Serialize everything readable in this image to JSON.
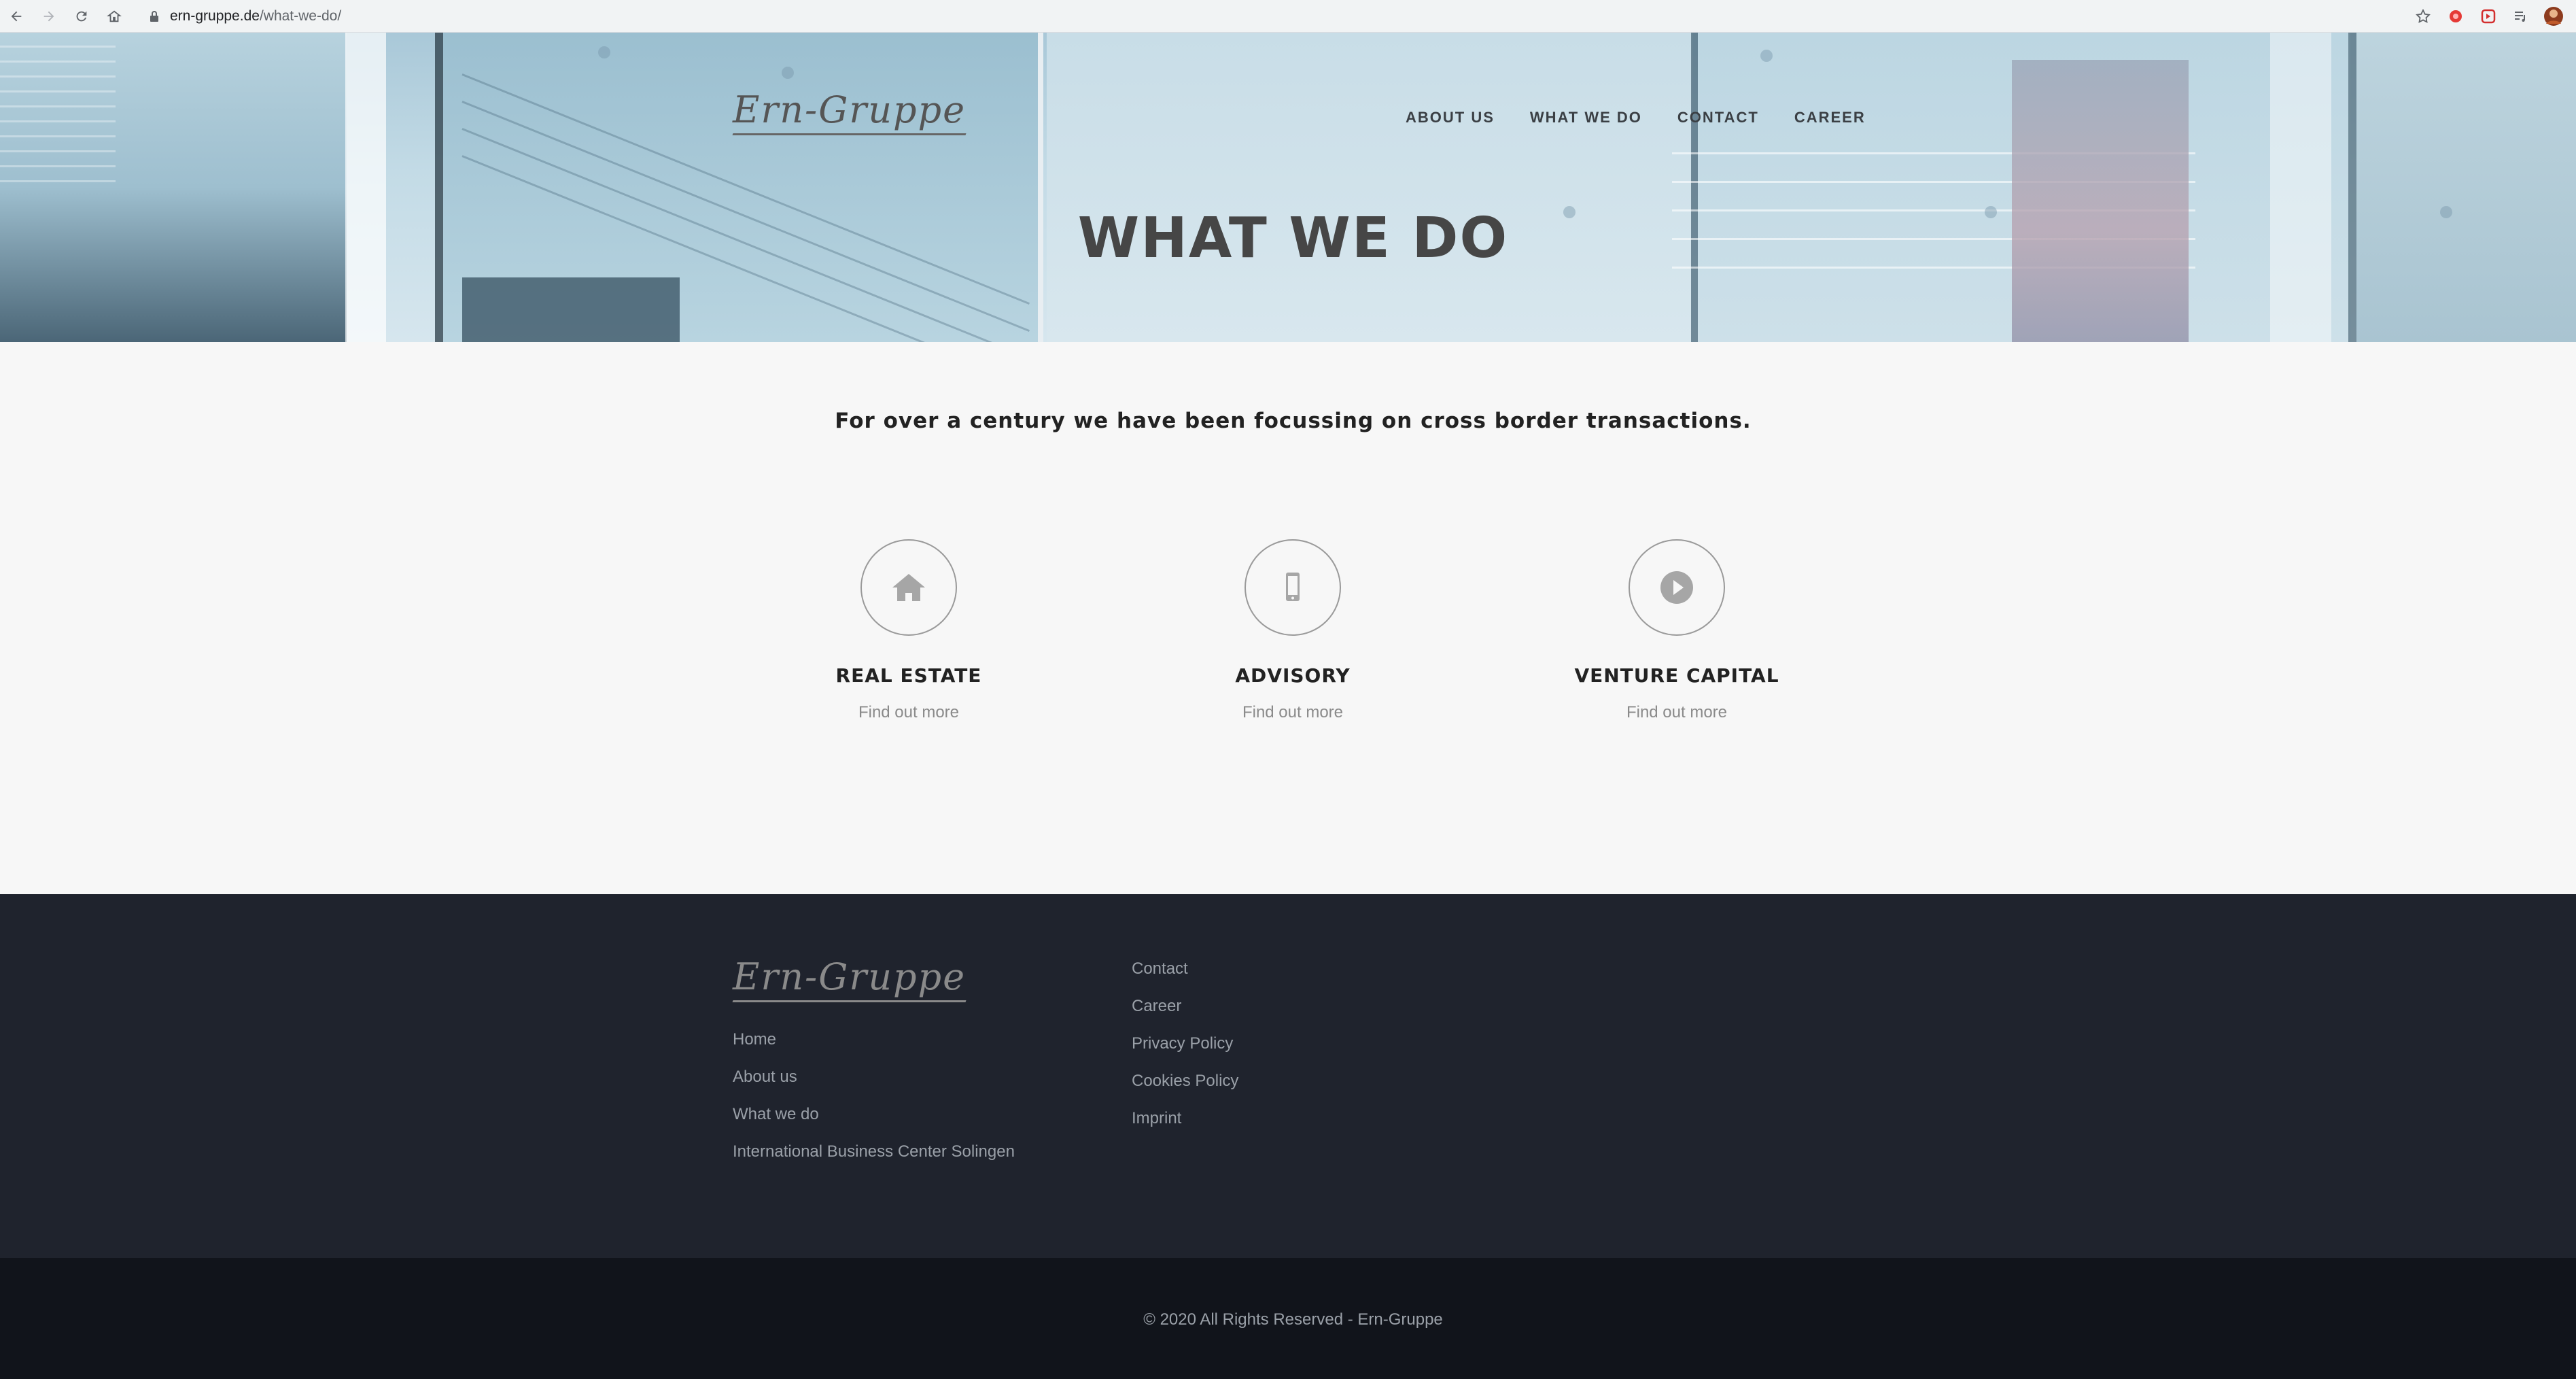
{
  "browser": {
    "url_domain": "ern-gruppe.de",
    "url_path": "/what-we-do/"
  },
  "site": {
    "logo_text": "Ern-Gruppe",
    "nav": [
      "ABOUT US",
      "WHAT WE DO",
      "CONTACT",
      "CAREER"
    ]
  },
  "hero": {
    "title": "WHAT WE DO"
  },
  "main": {
    "tagline": "For over a century we have been focussing on cross border transactions.",
    "services": [
      {
        "title": "REAL ESTATE",
        "link": "Find out more",
        "icon": "home-icon"
      },
      {
        "title": "ADVISORY",
        "link": "Find out more",
        "icon": "mobile-phone-icon"
      },
      {
        "title": "VENTURE CAPITAL",
        "link": "Find out more",
        "icon": "play-circle-icon"
      }
    ]
  },
  "footer": {
    "logo_text": "Ern-Gruppe",
    "col1": [
      "Home",
      "About us",
      "What we do",
      "International Business Center Solingen"
    ],
    "col2": [
      "Contact",
      "Career",
      "Privacy Policy",
      "Cookies Policy",
      "Imprint"
    ],
    "copyright": "© 2020 All Rights Reserved - Ern-Gruppe"
  }
}
